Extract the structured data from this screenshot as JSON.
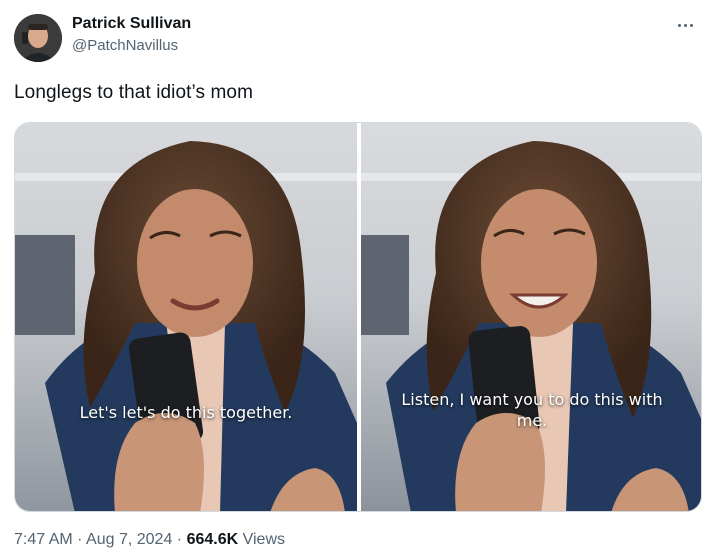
{
  "author": {
    "display_name": "Patrick Sullivan",
    "handle": "@PatchNavillus",
    "avatar_icon": "profile-avatar"
  },
  "menu": {
    "icon": "more-horizontal-icon"
  },
  "tweet": {
    "text": "Longlegs to that idiot’s mom"
  },
  "media": {
    "images": [
      {
        "caption": "Let's let's do this together."
      },
      {
        "caption": "Listen, I want you to do this with me."
      }
    ]
  },
  "meta": {
    "time": "7:47 AM",
    "separator_1": " · ",
    "date": "Aug 7, 2024",
    "separator_2": " · ",
    "views_count": "664.6K",
    "views_label": " Views"
  },
  "colors": {
    "text_primary": "#0f1419",
    "text_secondary": "#536471",
    "border": "#cfd9de",
    "jacket": "#233a5e"
  }
}
